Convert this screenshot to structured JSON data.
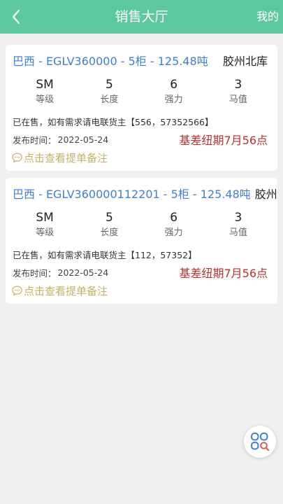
{
  "header": {
    "title": "销售大厅",
    "right_label": "我的",
    "back_icon": "chevron-left-icon"
  },
  "colors": {
    "header_bg": "#5cc8a0",
    "title_blue": "#3d7fd6",
    "price_red": "#b83232",
    "note_gold": "#c8b066"
  },
  "listings": [
    {
      "title": "巴西 - EGLV360000 - 5柜 - 125.48吨",
      "location": "胶州北库",
      "specs": [
        {
          "value": "SM",
          "label": "等级"
        },
        {
          "value": "5",
          "label": "长度"
        },
        {
          "value": "6",
          "label": "强力"
        },
        {
          "value": "3",
          "label": "马值"
        }
      ],
      "status": "已在售，如有需求请电联货主【556，57352566】",
      "date_label": "发布时间：",
      "date": "2022-05-24",
      "price": "基差纽期7月56点",
      "note_link": "点击查看提单备注"
    },
    {
      "title": "巴西 - EGLV360000112201 - 5柜 - 125.48吨",
      "location": "胶州北库",
      "specs": [
        {
          "value": "SM",
          "label": "等级"
        },
        {
          "value": "5",
          "label": "长度"
        },
        {
          "value": "6",
          "label": "强力"
        },
        {
          "value": "3",
          "label": "马值"
        }
      ],
      "status": "已在售，如有需求请电联货主【112，57352】",
      "date_label": "发布时间：",
      "date": "2022-05-24",
      "price": "基差纽期7月56点",
      "note_link": "点击查看提单备注"
    }
  ],
  "fab": {
    "icon": "apps-search-icon"
  }
}
